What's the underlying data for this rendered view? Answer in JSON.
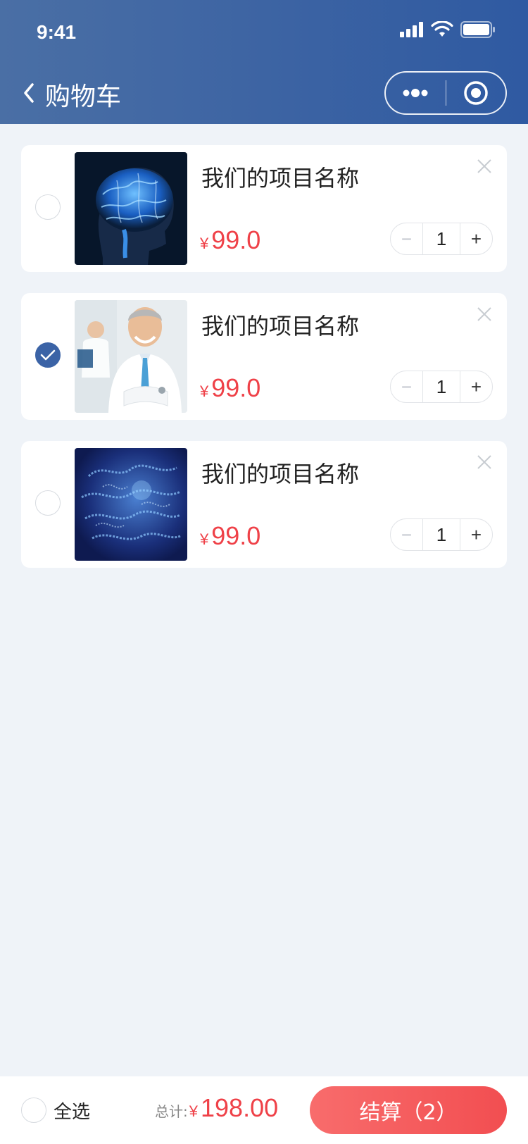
{
  "status_bar": {
    "time": "9:41"
  },
  "nav": {
    "title": "购物车"
  },
  "cart": {
    "items": [
      {
        "name": "我们的项目名称",
        "currency": "¥",
        "price": "99.0",
        "quantity": "1",
        "minus": "−",
        "plus": "+",
        "checked": false
      },
      {
        "name": "我们的项目名称",
        "currency": "¥",
        "price": "99.0",
        "quantity": "1",
        "minus": "−",
        "plus": "+",
        "checked": true
      },
      {
        "name": "我们的项目名称",
        "currency": "¥",
        "price": "99.0",
        "quantity": "1",
        "minus": "−",
        "plus": "+",
        "checked": false
      }
    ]
  },
  "footer": {
    "select_all": "全选",
    "total_label": "总计:",
    "total_currency": "¥",
    "total_amount": "198.00",
    "checkout_label": "结算（2）"
  },
  "colors": {
    "header": "#3d64a3",
    "accent": "#ef4148",
    "checkbox_checked": "#3b63a6",
    "background": "#eff3f8"
  }
}
